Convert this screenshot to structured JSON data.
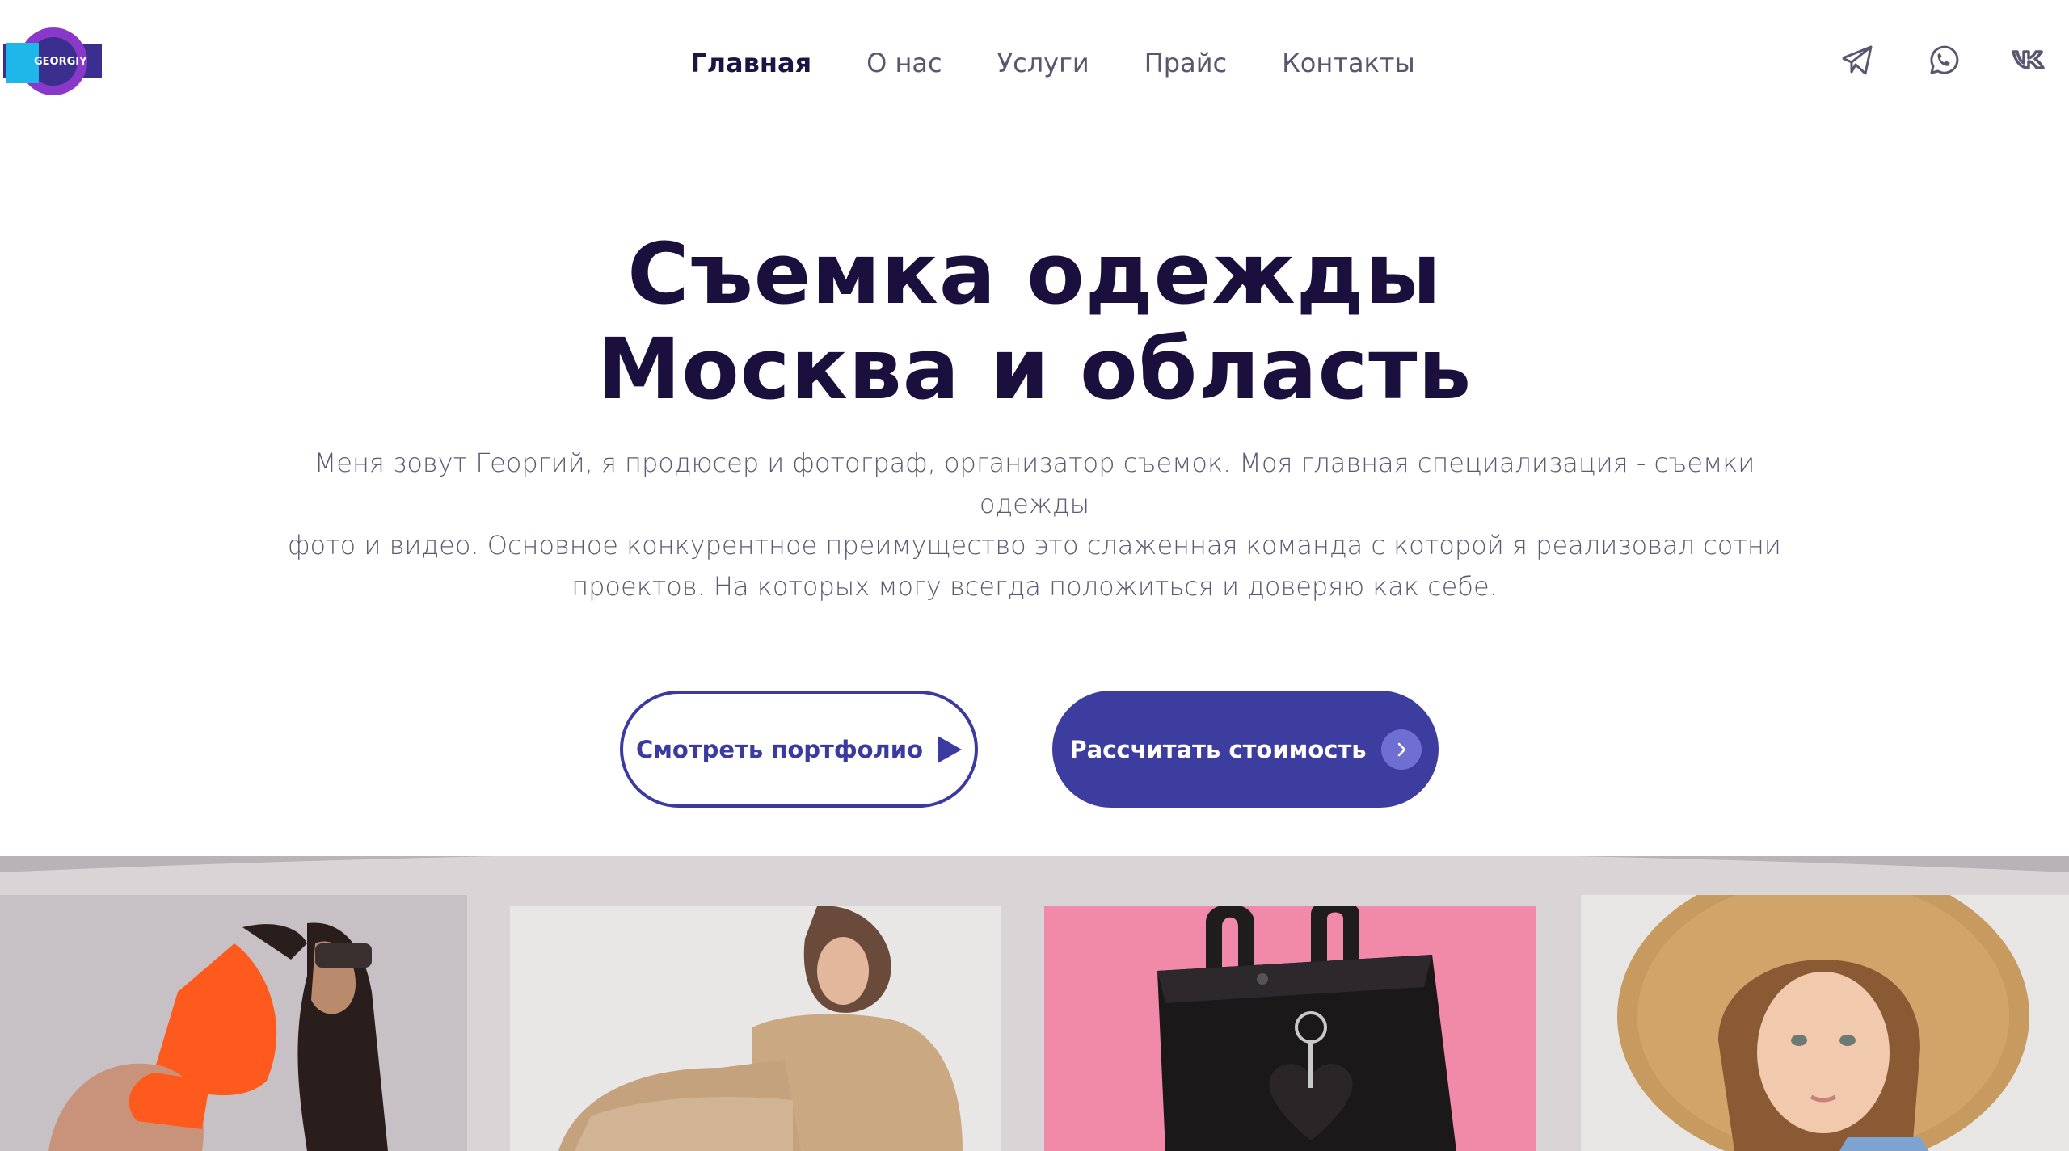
{
  "header": {
    "logo_text": "GEORGIY",
    "nav": [
      {
        "label": "Главная",
        "active": true
      },
      {
        "label": "О нас",
        "active": false
      },
      {
        "label": "Услуги",
        "active": false
      },
      {
        "label": "Прайс",
        "active": false
      },
      {
        "label": "Контакты",
        "active": false
      }
    ],
    "social": [
      "telegram-icon",
      "whatsapp-icon",
      "vk-icon"
    ]
  },
  "hero": {
    "title_line1": "Съемка одежды",
    "title_line2": "Москва и область",
    "description_line1": "Меня зовут Георгий, я продюсер и фотограф, организатор съемок. Моя главная специализация - съемки одежды",
    "description_line2": "фото и видео. Основное конкурентное преимущество это слаженная команда с которой я реализовал сотни",
    "description_line3": "проектов. На которых могу всегда положиться и доверяю как себе."
  },
  "buttons": {
    "portfolio_label": "Смотреть портфолио",
    "calculate_label": "Рассчитать стоимость"
  },
  "colors": {
    "accent": "#3d3d9f",
    "heading": "#1a0f3d",
    "text": "#5e5a73"
  }
}
